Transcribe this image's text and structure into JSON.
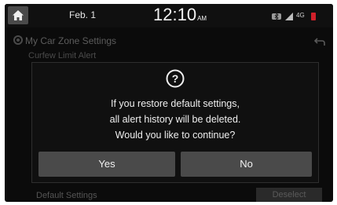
{
  "status_bar": {
    "date": "Feb.  1",
    "time": "12:10",
    "ampm": "AM",
    "icons": [
      "bluetooth-icon",
      "signal-icon",
      "lte-icon",
      "battery-icon"
    ]
  },
  "background": {
    "title": "My Car Zone Settings",
    "row1": "Curfew Limit Alert",
    "footer_left": "Default Settings",
    "footer_right": "Deselect"
  },
  "dialog": {
    "icon": "question-icon",
    "lines": [
      "If you restore default settings,",
      "all alert history will be deleted.",
      "Would you like to continue?"
    ],
    "yes_label": "Yes",
    "no_label": "No"
  },
  "colors": {
    "screen_bg": "#0b0b0b",
    "button_bg": "#4a4a4a",
    "text": "#efefef",
    "battery_red": "#d0202a"
  }
}
